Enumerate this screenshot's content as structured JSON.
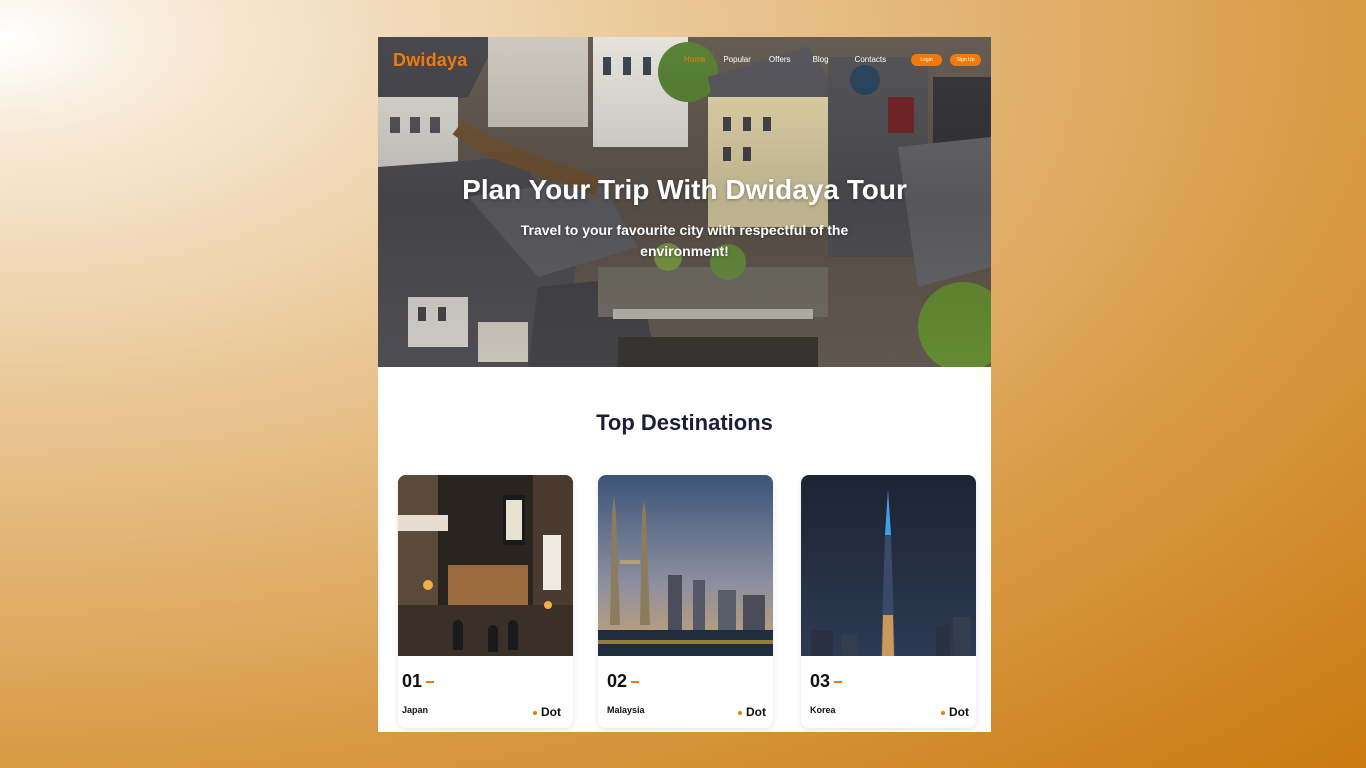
{
  "nav": {
    "logo": "Dwidaya",
    "links": [
      {
        "label": "Home",
        "active": true
      },
      {
        "label": "Popular",
        "active": false
      },
      {
        "label": "Offers",
        "active": false
      },
      {
        "label": "Blog",
        "active": false
      },
      {
        "label": "Contacts",
        "active": false
      }
    ],
    "login_label": "Login",
    "signup_label": "Sign Up"
  },
  "hero": {
    "title": "Plan Your Trip With Dwidaya Tour",
    "subtitle": "Travel to your favourite city with respectful of the environment!"
  },
  "destinations": {
    "title": "Top Destinations",
    "cards": [
      {
        "number": "01",
        "name": "Japan",
        "dot_label": "Dot"
      },
      {
        "number": "02",
        "name": "Malaysia",
        "dot_label": "Dot"
      },
      {
        "number": "03",
        "name": "Korea",
        "dot_label": "Dot"
      }
    ]
  },
  "colors": {
    "accent": "#f07a0c",
    "heading": "#1d1d3a"
  }
}
